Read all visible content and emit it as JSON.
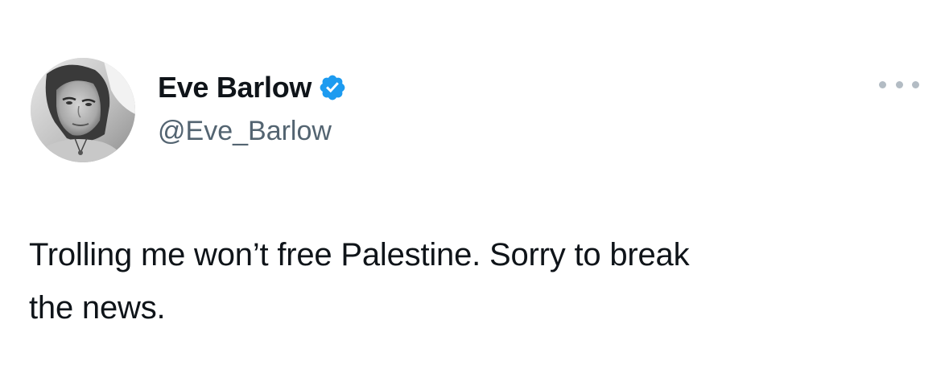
{
  "author": {
    "display_name": "Eve Barlow",
    "handle": "@Eve_Barlow",
    "verified": true,
    "verified_color": "#1d9bf0"
  },
  "tweet": {
    "text_line_1": "Trolling me won’t free Palestine. Sorry to break",
    "text_line_2": "the news."
  },
  "icons": {
    "more": "more-options-icon",
    "verified": "verified-badge-icon"
  }
}
